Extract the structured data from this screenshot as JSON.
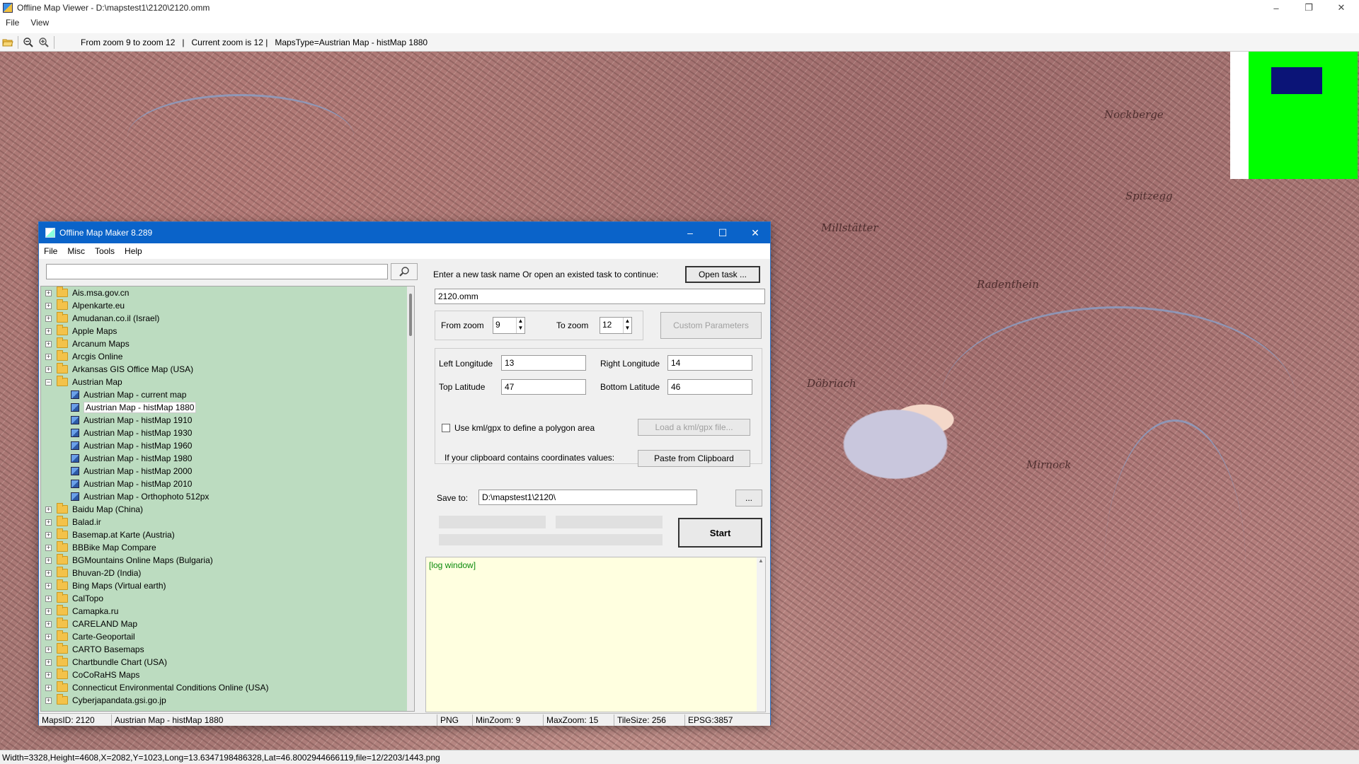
{
  "window": {
    "title": "Offline Map Viewer - D:\\mapstest1\\2120\\2120.omm",
    "controls": {
      "minimize": "–",
      "restore": "❐",
      "close": "✕"
    }
  },
  "menu": [
    "File",
    "View"
  ],
  "toolbar": {
    "info": "From zoom 9 to zoom 12   |   Current zoom is 12 |   MapsType=Austrian Map - histMap 1880",
    "icons": [
      "folder-open-icon",
      "zoom-out-icon",
      "zoom-in-icon"
    ]
  },
  "map": {
    "place_labels": [
      "Millstätter",
      "Mirnock",
      "Spitzegg",
      "Radenthein",
      "Döbriach",
      "Nockberge"
    ]
  },
  "statusbar": "Width=3328,Height=4608,X=2082,Y=1023,Long=13.6347198486328,Lat=46.8002944666119,file=12/2203/1443.png",
  "dialog": {
    "title": "Offline Map Maker 8.289",
    "menu": [
      "File",
      "Misc",
      "Tools",
      "Help"
    ],
    "search": {
      "value": "",
      "placeholder": ""
    },
    "tree": [
      {
        "label": "Ais.msa.gov.cn",
        "type": "folder",
        "level": 0
      },
      {
        "label": "Alpenkarte.eu",
        "type": "folder",
        "level": 0
      },
      {
        "label": "Amudanan.co.il (Israel)",
        "type": "folder",
        "level": 0
      },
      {
        "label": "Apple Maps",
        "type": "folder",
        "level": 0
      },
      {
        "label": "Arcanum Maps",
        "type": "folder",
        "level": 0
      },
      {
        "label": "Arcgis Online",
        "type": "folder",
        "level": 0
      },
      {
        "label": "Arkansas GIS Office Map (USA)",
        "type": "folder",
        "level": 0
      },
      {
        "label": "Austrian Map",
        "type": "folder",
        "level": 0,
        "expanded": true
      },
      {
        "label": "Austrian Map - current map",
        "type": "map",
        "level": 1
      },
      {
        "label": "Austrian Map - histMap 1880",
        "type": "map",
        "level": 1,
        "selected": true
      },
      {
        "label": "Austrian Map - histMap 1910",
        "type": "map",
        "level": 1
      },
      {
        "label": "Austrian Map - histMap 1930",
        "type": "map",
        "level": 1
      },
      {
        "label": "Austrian Map - histMap 1960",
        "type": "map",
        "level": 1
      },
      {
        "label": "Austrian Map - histMap 1980",
        "type": "map",
        "level": 1
      },
      {
        "label": "Austrian Map - histMap 2000",
        "type": "map",
        "level": 1
      },
      {
        "label": "Austrian Map - histMap 2010",
        "type": "map",
        "level": 1
      },
      {
        "label": "Austrian Map - Orthophoto 512px",
        "type": "map",
        "level": 1
      },
      {
        "label": "Baidu Map (China)",
        "type": "folder",
        "level": 0
      },
      {
        "label": "Balad.ir",
        "type": "folder",
        "level": 0
      },
      {
        "label": "Basemap.at Karte (Austria)",
        "type": "folder",
        "level": 0
      },
      {
        "label": "BBBike Map Compare",
        "type": "folder",
        "level": 0
      },
      {
        "label": "BGMountains Online Maps (Bulgaria)",
        "type": "folder",
        "level": 0
      },
      {
        "label": "Bhuvan-2D (India)",
        "type": "folder",
        "level": 0
      },
      {
        "label": "Bing Maps (Virtual earth)",
        "type": "folder",
        "level": 0
      },
      {
        "label": "CalTopo",
        "type": "folder",
        "level": 0
      },
      {
        "label": "Camapka.ru",
        "type": "folder",
        "level": 0
      },
      {
        "label": "CARELAND Map",
        "type": "folder",
        "level": 0
      },
      {
        "label": "Carte-Geoportail",
        "type": "folder",
        "level": 0
      },
      {
        "label": "CARTO Basemaps",
        "type": "folder",
        "level": 0
      },
      {
        "label": "Chartbundle Chart (USA)",
        "type": "folder",
        "level": 0
      },
      {
        "label": "CoCoRaHS Maps",
        "type": "folder",
        "level": 0
      },
      {
        "label": "Connecticut Environmental Conditions Online (USA)",
        "type": "folder",
        "level": 0
      },
      {
        "label": "Cyberjapandata.gsi.go.jp",
        "type": "folder",
        "level": 0
      }
    ],
    "task": {
      "prompt": "Enter a new task name Or open an existed task to continue:",
      "open_button": "Open task ...",
      "name": "2120.omm"
    },
    "zoom": {
      "from_label": "From zoom",
      "from_value": "9",
      "to_label": "To zoom",
      "to_value": "12",
      "custom_button": "Custom Parameters"
    },
    "coords": {
      "left_lon_label": "Left Longitude",
      "left_lon": "13",
      "right_lon_label": "Right Longitude",
      "right_lon": "14",
      "top_lat_label": "Top Latitude",
      "top_lat": "47",
      "bottom_lat_label": "Bottom Latitude",
      "bottom_lat": "46",
      "kml_checkbox_label": "Use kml/gpx to define a polygon area",
      "kml_checked": false,
      "load_kml_button": "Load a kml/gpx file...",
      "clipboard_text": "If your clipboard contains coordinates values:",
      "paste_button": "Paste from Clipboard"
    },
    "save": {
      "label": "Save to:",
      "path": "D:\\mapstest1\\2120\\",
      "browse_button": "..."
    },
    "start_button": "Start",
    "log_text": "[log window]",
    "status": {
      "maps_id": "MapsID: 2120",
      "map_name": "Austrian Map - histMap 1880",
      "format": "PNG",
      "min_zoom": "MinZoom: 9",
      "max_zoom": "MaxZoom: 15",
      "tile_size": "TileSize: 256",
      "epsg": "EPSG:3857"
    }
  }
}
